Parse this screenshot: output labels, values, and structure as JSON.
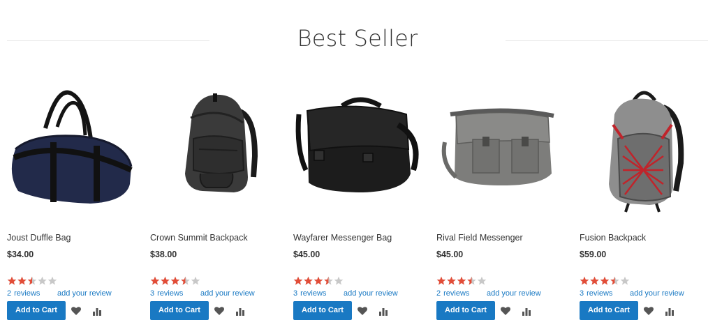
{
  "section": {
    "title": "Best Seller"
  },
  "colors": {
    "accent": "#1979c3",
    "star": "#e24d38",
    "star_empty": "#c8c8c8",
    "icon": "#555555"
  },
  "products": [
    {
      "name": "Joust Duffle Bag",
      "price": "$34.00",
      "rating_fraction": 0.5,
      "reviews_count": "2",
      "reviews_label": "reviews",
      "add_review": "add your review",
      "add_to_cart": "Add to Cart",
      "image_icon": "duffle-bag-icon"
    },
    {
      "name": "Crown Summit Backpack",
      "price": "$38.00",
      "rating_fraction": 0.7,
      "reviews_count": "3",
      "reviews_label": "reviews",
      "add_review": "add your review",
      "add_to_cart": "Add to Cart",
      "image_icon": "backpack-icon"
    },
    {
      "name": "Wayfarer Messenger Bag",
      "price": "$45.00",
      "rating_fraction": 0.7,
      "reviews_count": "3",
      "reviews_label": "reviews",
      "add_review": "add your review",
      "add_to_cart": "Add to Cart",
      "image_icon": "messenger-bag-icon"
    },
    {
      "name": "Rival Field Messenger",
      "price": "$45.00",
      "rating_fraction": 0.7,
      "reviews_count": "2",
      "reviews_label": "reviews",
      "add_review": "add your review",
      "add_to_cart": "Add to Cart",
      "image_icon": "field-messenger-icon"
    },
    {
      "name": "Fusion Backpack",
      "price": "$59.00",
      "rating_fraction": 0.7,
      "reviews_count": "3",
      "reviews_label": "reviews",
      "add_review": "add your review",
      "add_to_cart": "Add to Cart",
      "image_icon": "gray-backpack-icon"
    }
  ]
}
